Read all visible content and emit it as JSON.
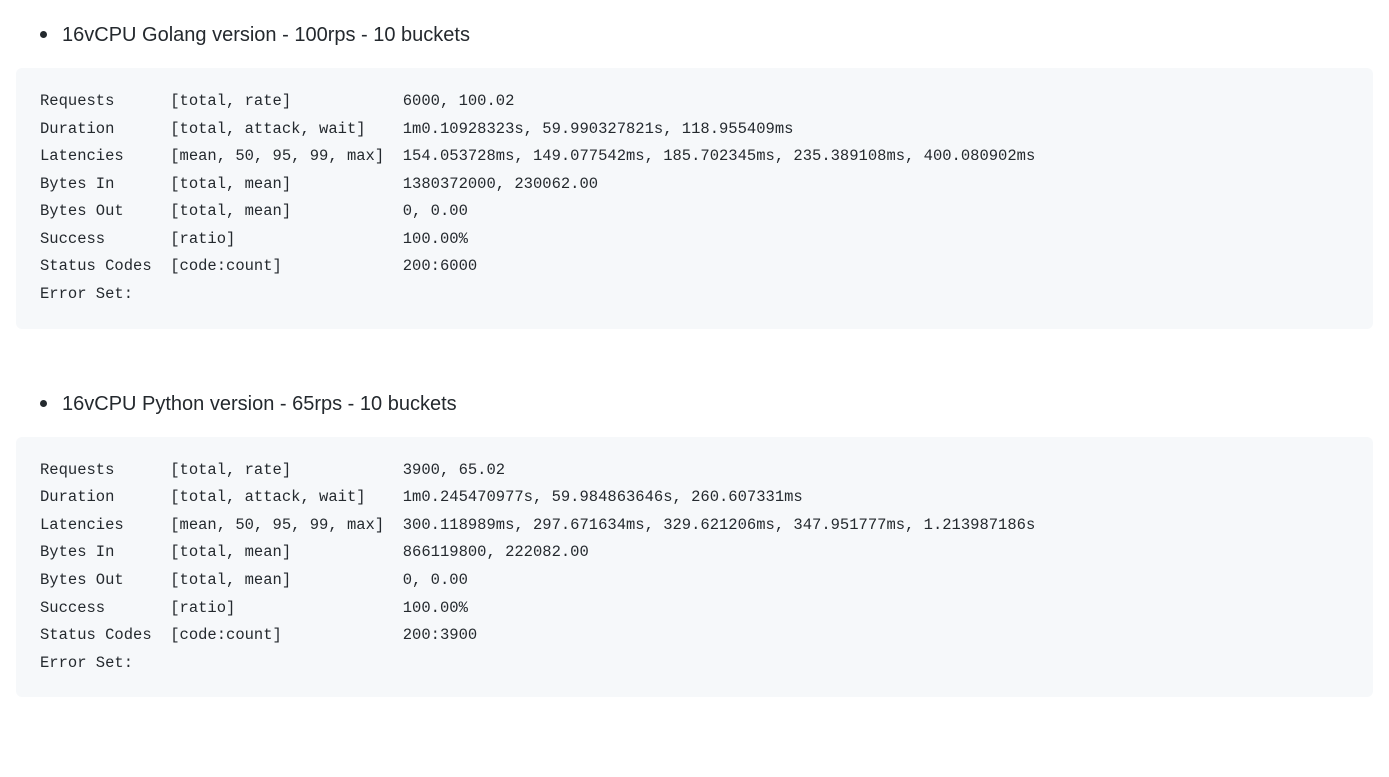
{
  "sections": [
    {
      "title": "16vCPU Golang version - 100rps - 10 buckets",
      "rows": [
        {
          "label": "Requests",
          "stats": "[total, rate]",
          "value": "6000, 100.02"
        },
        {
          "label": "Duration",
          "stats": "[total, attack, wait]",
          "value": "1m0.10928323s, 59.990327821s, 118.955409ms"
        },
        {
          "label": "Latencies",
          "stats": "[mean, 50, 95, 99, max]",
          "value": "154.053728ms, 149.077542ms, 185.702345ms, 235.389108ms, 400.080902ms"
        },
        {
          "label": "Bytes In",
          "stats": "[total, mean]",
          "value": "1380372000, 230062.00"
        },
        {
          "label": "Bytes Out",
          "stats": "[total, mean]",
          "value": "0, 0.00"
        },
        {
          "label": "Success",
          "stats": "[ratio]",
          "value": "100.00%"
        },
        {
          "label": "Status Codes",
          "stats": "[code:count]",
          "value": "200:6000"
        },
        {
          "label": "Error Set:",
          "stats": "",
          "value": ""
        }
      ]
    },
    {
      "title": "16vCPU Python version - 65rps - 10 buckets",
      "rows": [
        {
          "label": "Requests",
          "stats": "[total, rate]",
          "value": "3900, 65.02"
        },
        {
          "label": "Duration",
          "stats": "[total, attack, wait]",
          "value": "1m0.245470977s, 59.984863646s, 260.607331ms"
        },
        {
          "label": "Latencies",
          "stats": "[mean, 50, 95, 99, max]",
          "value": "300.118989ms, 297.671634ms, 329.621206ms, 347.951777ms, 1.213987186s"
        },
        {
          "label": "Bytes In",
          "stats": "[total, mean]",
          "value": "866119800, 222082.00"
        },
        {
          "label": "Bytes Out",
          "stats": "[total, mean]",
          "value": "0, 0.00"
        },
        {
          "label": "Success",
          "stats": "[ratio]",
          "value": "100.00%"
        },
        {
          "label": "Status Codes",
          "stats": "[code:count]",
          "value": "200:3900"
        },
        {
          "label": "Error Set:",
          "stats": "",
          "value": ""
        }
      ]
    }
  ]
}
